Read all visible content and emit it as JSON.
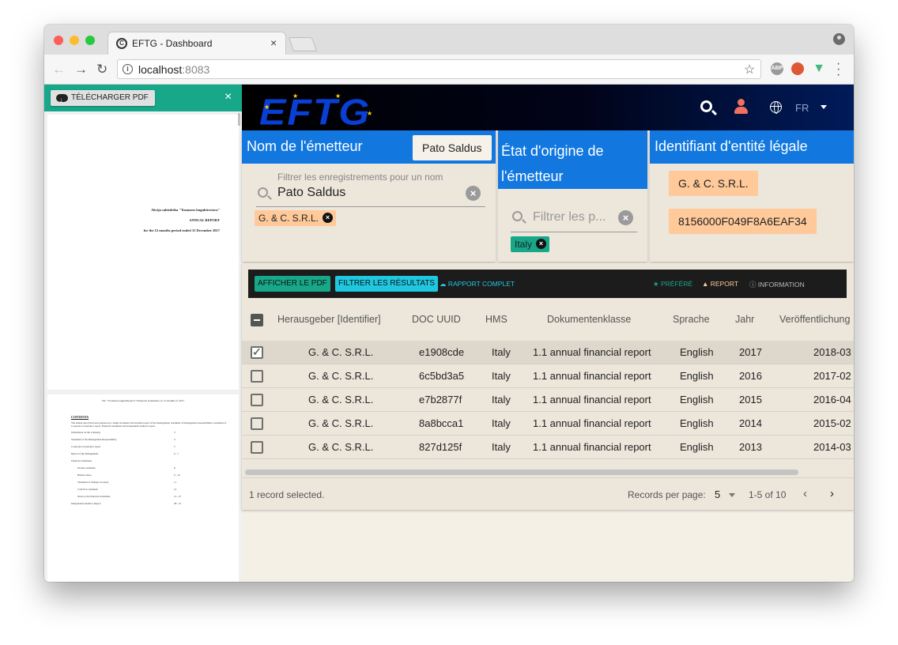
{
  "browser": {
    "tab_title": "EFTG - Dashboard",
    "tab_close": "×",
    "url_host": "localhost",
    "url_port": ":8083",
    "nav_back": "←",
    "nav_forward": "→",
    "nav_reload": "↻",
    "star": "☆",
    "ext_abp": "ABP"
  },
  "pdf": {
    "download_label": "TÉLÉCHARGER PDF",
    "close": "×",
    "page1_lines": [
      "Akcija sabiedriba \"Tosmares kugubūvetava\"",
      "ANNUAL REPORT",
      "for the 12 months period ended 31 December 2017"
    ],
    "page2_header": "JSC \"Tosmares kugubūvetava\" Financial statements on 12 months of 2017",
    "page2_title": "CONTENTS",
    "page2_intro": "The annual report has been prepared as a single document and includes report of the management, statement of management responsibilities, statement of Corporate Governance report, financial statements and independent auditor's report.",
    "page2_rows": [
      {
        "label": "Information on the Company",
        "page": "3"
      },
      {
        "label": "Statement of the Management Responsibility",
        "page": "4"
      },
      {
        "label": "Corporate Governance report",
        "page": "5"
      },
      {
        "label": "Report of the Management",
        "page": "6 - 7"
      },
      {
        "label": "Financial statements",
        "page": ""
      },
      {
        "label": "Income statement",
        "page": "8"
      },
      {
        "label": "Balance sheet",
        "page": "9 - 10"
      },
      {
        "label": "Statement of changes in equity",
        "page": "11"
      },
      {
        "label": "Cash flow statement",
        "page": "12"
      },
      {
        "label": "Notes to the financial statements",
        "page": "13 - 27"
      },
      {
        "label": "Independent Auditor's Report",
        "page": "28 - 31"
      }
    ]
  },
  "header": {
    "logo": "EFTG",
    "lang": "FR"
  },
  "filters": {
    "issuer": {
      "title": "Nom de l'émetteur",
      "selected_button": "Pato Saldus",
      "search_label": "Filtrer les enregistrements pour un nom",
      "search_value": "Pato Saldus",
      "clear": "×",
      "chip": "G. & C. S.R.L.",
      "chip_x": "×"
    },
    "origin": {
      "title_line1": "État d'origine de",
      "title_line2": "l'émetteur",
      "search_placeholder": "Filtrer les p...",
      "clear": "×",
      "chip": "Italy",
      "chip_x": "×"
    },
    "lei": {
      "title": "Identifiant d'entité légale",
      "tags": [
        "G. & C. S.R.L.",
        "8156000F049F8A6EAF34"
      ]
    }
  },
  "actions": {
    "show_pdf": "AFFICHER LE PDF",
    "filter_results": "FILTRER LES RÉSULTATS",
    "full_report": "RAPPORT COMPLET",
    "preferred": "PRÉFÉRÉ",
    "report": "REPORT",
    "information": "INFORMATION"
  },
  "table": {
    "columns": [
      "Herausgeber [Identifier]",
      "DOC UUID",
      "HMS",
      "Dokumentenklasse",
      "Sprache",
      "Jahr",
      "Veröffentlichung"
    ],
    "rows": [
      {
        "issuer": "G. & C. S.R.L.",
        "uuid": "e1908cde",
        "hms": "Italy",
        "class": "1.1 annual financial report",
        "lang": "English",
        "year": "2017",
        "pub": "2018-03",
        "selected": true
      },
      {
        "issuer": "G. & C. S.R.L.",
        "uuid": "6c5bd3a5",
        "hms": "Italy",
        "class": "1.1 annual financial report",
        "lang": "English",
        "year": "2016",
        "pub": "2017-02",
        "selected": false
      },
      {
        "issuer": "G. & C. S.R.L.",
        "uuid": "e7b2877f",
        "hms": "Italy",
        "class": "1.1 annual financial report",
        "lang": "English",
        "year": "2015",
        "pub": "2016-04",
        "selected": false
      },
      {
        "issuer": "G. & C. S.R.L.",
        "uuid": "8a8bcca1",
        "hms": "Italy",
        "class": "1.1 annual financial report",
        "lang": "English",
        "year": "2014",
        "pub": "2015-02",
        "selected": false
      },
      {
        "issuer": "G. & C. S.R.L.",
        "uuid": "827d125f",
        "hms": "Italy",
        "class": "1.1 annual financial report",
        "lang": "English",
        "year": "2013",
        "pub": "2014-03",
        "selected": false
      }
    ],
    "footer": {
      "selected_text": "1 record selected.",
      "rpp_label": "Records per page:",
      "rpp_value": "5",
      "range": "1-5 of 10",
      "prev": "‹",
      "next": "›"
    }
  },
  "colors": {
    "teal": "#17a88a",
    "blue": "#1278e0",
    "orange_chip": "#ffc99a",
    "teal_chip": "#17a88a"
  }
}
